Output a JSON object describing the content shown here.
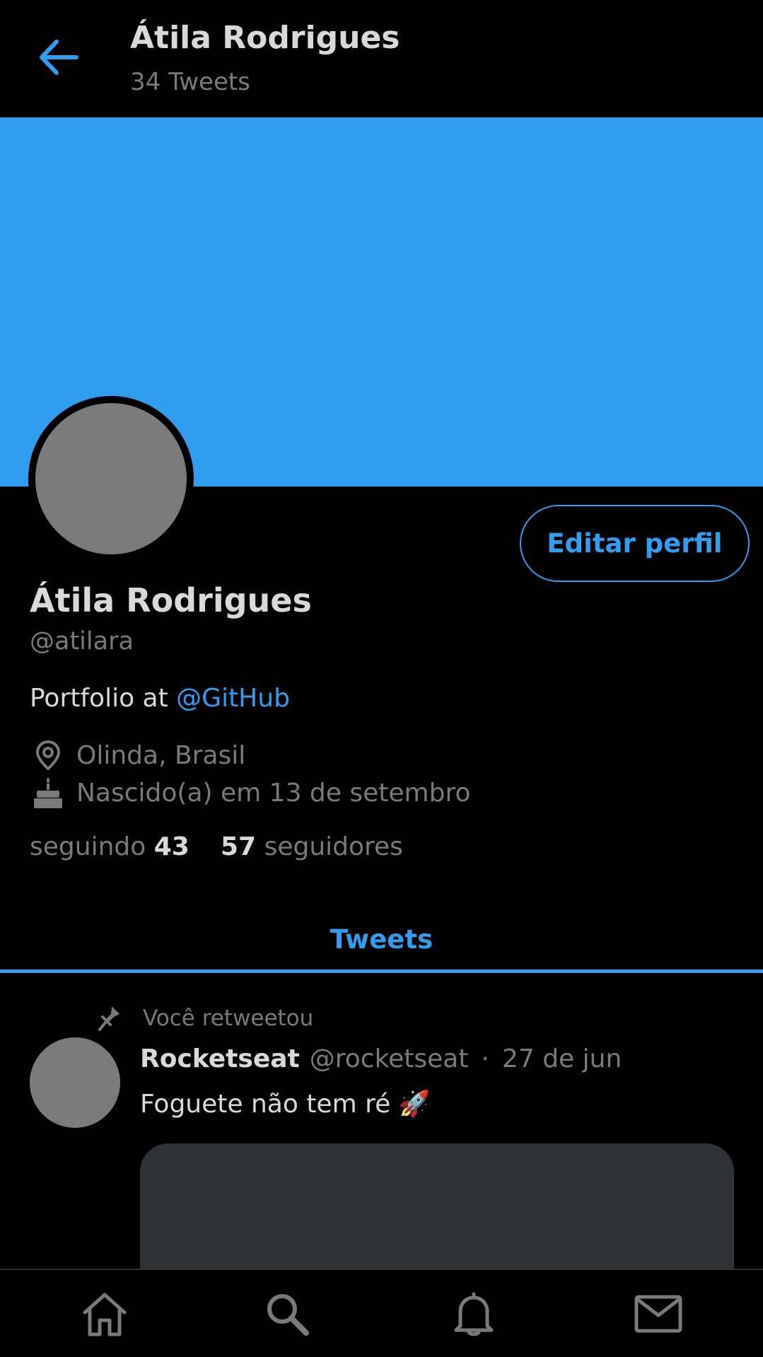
{
  "header": {
    "title": "Átila Rodrigues",
    "subtitle": "34 Tweets",
    "back_icon": "arrow-left-icon"
  },
  "colors": {
    "accent": "#319df0",
    "background": "#000000",
    "text_primary": "#d9d9d9",
    "text_secondary": "#7a7a7a",
    "avatar_placeholder": "#7b7b7b",
    "media_placeholder": "#2f3336"
  },
  "profile": {
    "edit_button_label": "Editar perfil",
    "name": "Átila Rodrigues",
    "handle": "@atilara",
    "bio_prefix": "Portfolio at ",
    "bio_mention": "@GitHub",
    "location": "Olinda, Brasil",
    "birthday": "Nascido(a) em 13 de setembro",
    "following_label": "seguindo",
    "following_count": "43",
    "followers_count": "57",
    "followers_label": "seguidores"
  },
  "tabs": [
    {
      "label": "Tweets",
      "active": true
    }
  ],
  "tweet": {
    "retweet_label": "Você retweetou",
    "author": "Rocketseat",
    "handle": "@rocketseat",
    "separator": "·",
    "date": "27 de jun",
    "text": "Foguete não tem ré 🚀"
  },
  "bottom_nav": [
    {
      "icon": "home-icon"
    },
    {
      "icon": "search-icon"
    },
    {
      "icon": "bell-icon"
    },
    {
      "icon": "mail-icon"
    }
  ]
}
